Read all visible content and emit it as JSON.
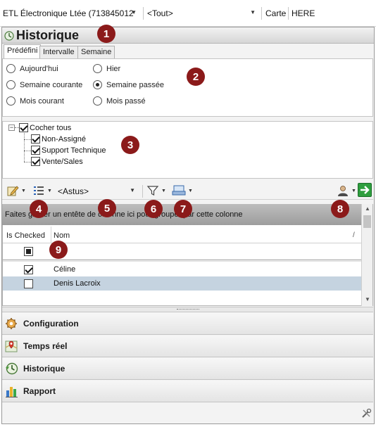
{
  "topbar": {
    "company": "ETL Électronique Ltée (713845012",
    "filter": "<Tout>",
    "map_label": "Carte",
    "map_value": "HERE"
  },
  "history": {
    "title": "Historique",
    "tabs": [
      {
        "label": "Prédéfini",
        "active": true
      },
      {
        "label": "Intervalle",
        "active": false
      },
      {
        "label": "Semaine",
        "active": false
      }
    ],
    "periods": [
      {
        "label": "Aujourd'hui",
        "selected": false
      },
      {
        "label": "Hier",
        "selected": false
      },
      {
        "label": "Semaine courante",
        "selected": false
      },
      {
        "label": "Semaine passée",
        "selected": true
      },
      {
        "label": "Mois courant",
        "selected": false
      },
      {
        "label": "Mois passé",
        "selected": false
      }
    ],
    "tree": {
      "root": "Cocher tous",
      "children": [
        "Non-Assigné",
        "Support Technique",
        "Vente/Sales"
      ]
    }
  },
  "toolbar": {
    "asset_filter": "<Astus>"
  },
  "grid": {
    "group_hint": "Faites glisser un entête de colonne ici pour grouper par cette colonne",
    "columns": [
      "Is Checked",
      "Nom"
    ],
    "rows": [
      {
        "name": "Céline",
        "checked": true,
        "selected": false
      },
      {
        "name": "Denis Lacroix",
        "checked": false,
        "selected": true
      }
    ]
  },
  "nav": [
    {
      "label": "Configuration",
      "icon": "configuration-icon"
    },
    {
      "label": "Temps réel",
      "icon": "map-pin-icon"
    },
    {
      "label": "Historique",
      "icon": "history-icon"
    },
    {
      "label": "Rapport",
      "icon": "bar-chart-icon"
    }
  ],
  "badges": [
    "1",
    "2",
    "3",
    "4",
    "5",
    "6",
    "7",
    "8",
    "9"
  ],
  "colors": {
    "badge": "#8b1a1a",
    "selected_row": "#c5d3e0",
    "go_button": "#2e9e3e"
  }
}
